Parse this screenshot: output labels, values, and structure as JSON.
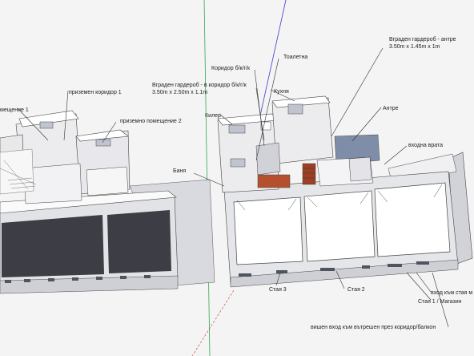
{
  "colors": {
    "background": "#f4f4f4",
    "wall_top": "#ffffff",
    "wall_side": "#d9dadf",
    "wall_dark": "#3c3d45",
    "glass_blue": "#7f8ea8",
    "brick": "#b5502f",
    "wood": "#9b3f25",
    "axis_green": "#2fa84a",
    "axis_blue": "#3a3ad0",
    "axis_red": "#c0392b"
  },
  "labels": {
    "room_left": "мещение 1",
    "ground_corridor": "приземен коридор 1",
    "ground_room2": "приземно помещение 2",
    "bath": "Баня",
    "corridor_bkgk": "Коридор б/к/г/к",
    "toilet": "Тоалетна",
    "wardrobe_corridor_1": "Вграден гардероб - в коридор б/к/г/к",
    "wardrobe_corridor_2": "3.50m x 2.50m x 1.1m",
    "kitchen": "Кухня",
    "kiler": "Килер",
    "wardrobe_hall_1": "Вграден гардероб - антре",
    "wardrobe_hall_2": "3.50m x 1.45m x 1m",
    "hall": "Антре",
    "entrance_door": "входна врата",
    "room3": "Стая 3",
    "room2": "Стая 2",
    "entry_room1": "вход към стая м",
    "room1_shop": "Стая 1 / Магазин",
    "elevated_entry": "вишен вход към вътрешен през коридор/балкон"
  }
}
